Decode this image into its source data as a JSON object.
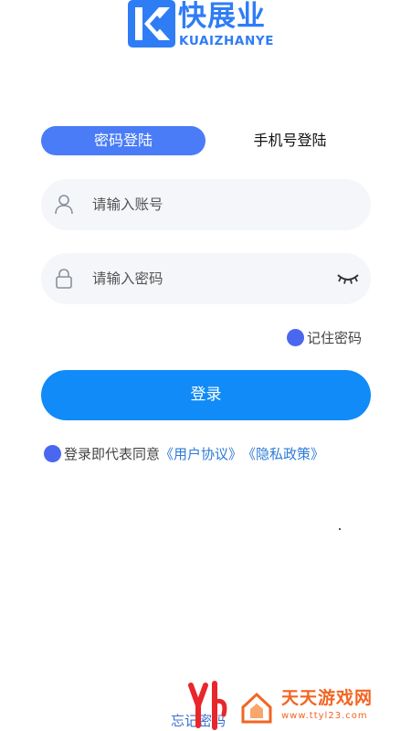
{
  "brand": {
    "name_cn": "快展业",
    "name_en": "KUAIZHANYE",
    "color": "#2f7df5"
  },
  "tabs": [
    {
      "label": "密码登陆",
      "active": true
    },
    {
      "label": "手机号登陆",
      "active": false
    }
  ],
  "form": {
    "account_placeholder": "请输入账号",
    "password_placeholder": "请输入密码",
    "account_icon": "user-icon",
    "password_icon": "lock-icon",
    "toggle_icon": "eye-closed-icon"
  },
  "remember": {
    "label": "记住密码",
    "checked": true
  },
  "login_button": {
    "label": "登录",
    "color": "#108bf8"
  },
  "agreement": {
    "prefix": "登录即代表同意",
    "user_agreement": "《用户协议》",
    "privacy_policy": "《隐私政策》"
  },
  "footer": {
    "forgot_label": "忘记密码"
  },
  "watermark": {
    "title": "天天游戏网",
    "url": "www.ttyl23.com"
  },
  "colors": {
    "accent": "#4a7cf7",
    "link": "#2d7bd6",
    "checkbox": "#4a67f0",
    "field_bg": "#f4f6f9"
  }
}
